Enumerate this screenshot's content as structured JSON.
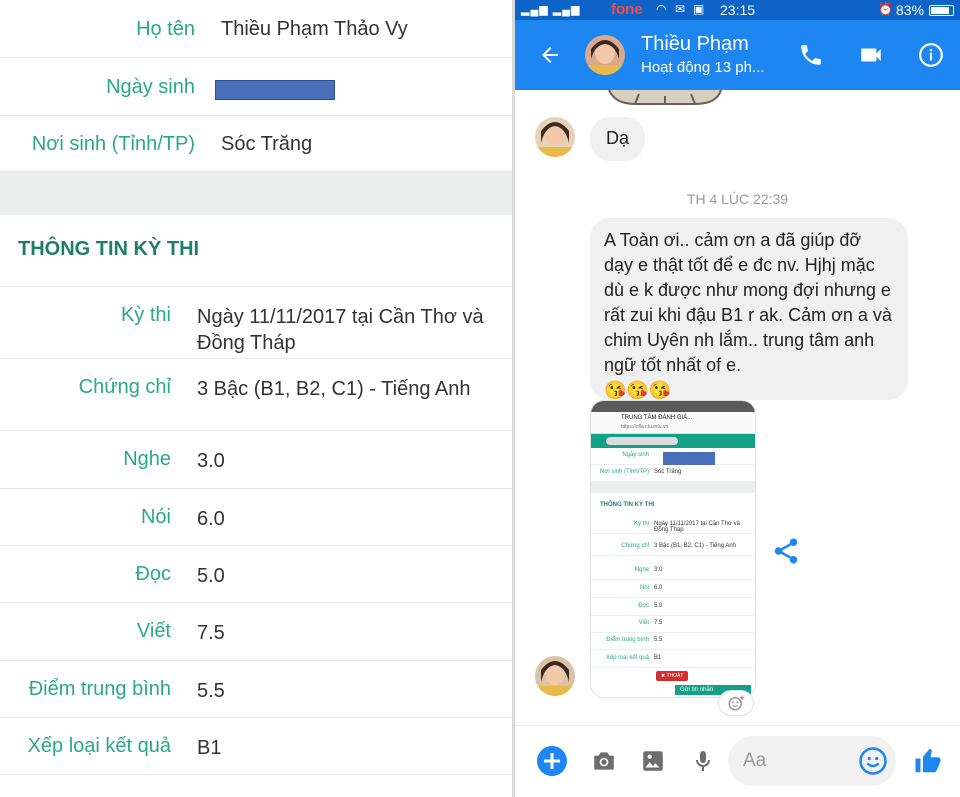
{
  "left": {
    "rows_top": [
      {
        "label": "Họ tên",
        "value": "Thiều Phạm Thảo Vy"
      },
      {
        "label": "Ngày sinh",
        "value": ""
      },
      {
        "label": "Nơi sinh (Tỉnh/TP)",
        "value": "Sóc Trăng"
      }
    ],
    "section_title": "THÔNG TIN KỲ THI",
    "exam_rows": [
      {
        "label": "Kỳ thi",
        "value": "Ngày 11/11/2017 tại Cần Thơ và Đồng Tháp"
      },
      {
        "label": "Chứng chỉ",
        "value": "3 Bậc (B1, B2, C1) - Tiếng Anh"
      },
      {
        "label": "Nghe",
        "value": "3.0"
      },
      {
        "label": "Nói",
        "value": "6.0"
      },
      {
        "label": "Đọc",
        "value": "5.0"
      },
      {
        "label": "Viết",
        "value": "7.5"
      },
      {
        "label": "Điểm trung bình",
        "value": "5.5"
      },
      {
        "label": "Xếp loại kết quả",
        "value": "B1"
      }
    ]
  },
  "status_bar": {
    "carrier": "fone",
    "time": "23:15",
    "battery": "83%"
  },
  "app_bar": {
    "name": "Thiều Phạm",
    "status": "Hoạt động 13 ph..."
  },
  "chat": {
    "msg1": "Dạ",
    "timestamp": "TH 4 LÚC 22:39",
    "msg2": "A Toàn ơi.. cảm ơn a đã giúp đỡ dạy e thật tốt để e đc nv. Hjhj mặc dù e k được như mong đợi nhưng e rất zui khi đậu B1 r ak. Cảm ơn a và chim Uyên nh lắm.. trung tâm anh ngữ tốt nhất of e.",
    "msg2_emojis": "😘😘😘"
  },
  "mini": {
    "page_title": "TRUNG TÂM ĐÁNH GIÁ...",
    "url": "https://cfla.ctu.edu.vn",
    "section_title": "THÔNG TIN KỲ THI",
    "exit_label": "✖ THOÁT",
    "send_label": "Gửi tin nhắn"
  },
  "composer": {
    "placeholder": "Aa"
  },
  "colors": {
    "accent_green": "#2aa88a",
    "messenger_blue": "#1e86f0",
    "statusbar_blue": "#0d63c8"
  }
}
